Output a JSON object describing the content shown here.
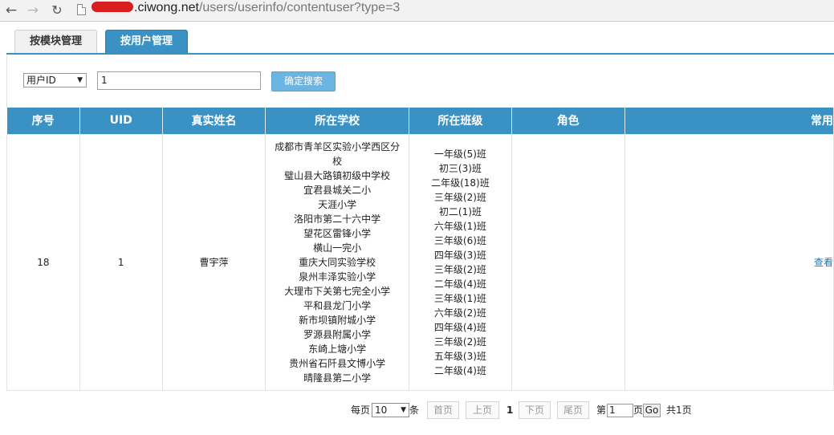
{
  "browser": {
    "url_host": ".ciwong.net",
    "url_path": "/users/userinfo/contentuser?type=3"
  },
  "tabs": [
    {
      "label": "按模块管理"
    },
    {
      "label": "按用户管理"
    }
  ],
  "search": {
    "field_select": "用户ID",
    "query": "1",
    "button_label": "确定搜索"
  },
  "table": {
    "headers": [
      "序号",
      "UID",
      "真实姓名",
      "所在学校",
      "所在班级",
      "角色",
      "常用"
    ],
    "rows": [
      {
        "index": "18",
        "uid": "1",
        "name": "曹宇萍",
        "schools": [
          "成都市青羊区实验小学西区分校",
          "璧山县大路镇初级中学校",
          "宜君县城关二小",
          "天涯小学",
          "洛阳市第二十六中学",
          "望花区雷锋小学",
          "横山一完小",
          "重庆大同实验学校",
          "泉州丰泽实验小学",
          "大理市下关第七完全小学",
          "平和县龙门小学",
          "新市坝镇附城小学",
          "罗源县附属小学",
          "东崎上塘小学",
          "贵州省石阡县文博小学",
          "晴隆县第二小学"
        ],
        "classes": [
          "一年级(5)班",
          "初三(3)班",
          "二年级(18)班",
          "三年级(2)班",
          "初二(1)班",
          "六年级(1)班",
          "三年级(6)班",
          "四年级(3)班",
          "三年级(2)班",
          "二年级(4)班",
          "三年级(1)班",
          "六年级(2)班",
          "四年级(4)班",
          "三年级(2)班",
          "五年级(3)班",
          "二年级(4)班"
        ],
        "role": "",
        "action": "查看"
      }
    ]
  },
  "pagination": {
    "per_page_prefix": "每页",
    "per_page_value": "10",
    "per_page_suffix": "条",
    "first": "首页",
    "prev": "上页",
    "current": "1",
    "next": "下页",
    "last": "尾页",
    "goto_prefix": "第",
    "goto_value": "1",
    "goto_suffix": "页",
    "go_label": "Go",
    "total": "共1页"
  }
}
